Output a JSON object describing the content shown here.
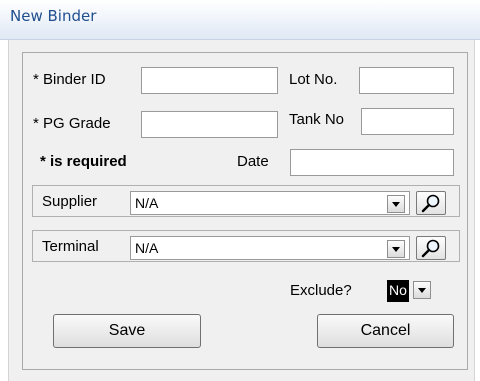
{
  "window": {
    "title": "New Binder"
  },
  "form": {
    "binder_id_label": "* Binder ID",
    "binder_id_value": "",
    "lot_no_label": "Lot No.",
    "lot_no_value": "",
    "pg_grade_label": "* PG Grade",
    "pg_grade_value": "",
    "tank_no_label": "Tank No",
    "tank_no_value": "",
    "required_note": "* is required",
    "date_label": "Date",
    "date_value": ""
  },
  "supplier": {
    "label": "Supplier",
    "value": "N/A"
  },
  "terminal": {
    "label": "Terminal",
    "value": "N/A"
  },
  "exclude": {
    "label": "Exclude?",
    "value": "No"
  },
  "buttons": {
    "save": "Save",
    "cancel": "Cancel"
  },
  "icons": {
    "search": "magnifier-icon",
    "dropdown": "chevron-down-icon"
  }
}
